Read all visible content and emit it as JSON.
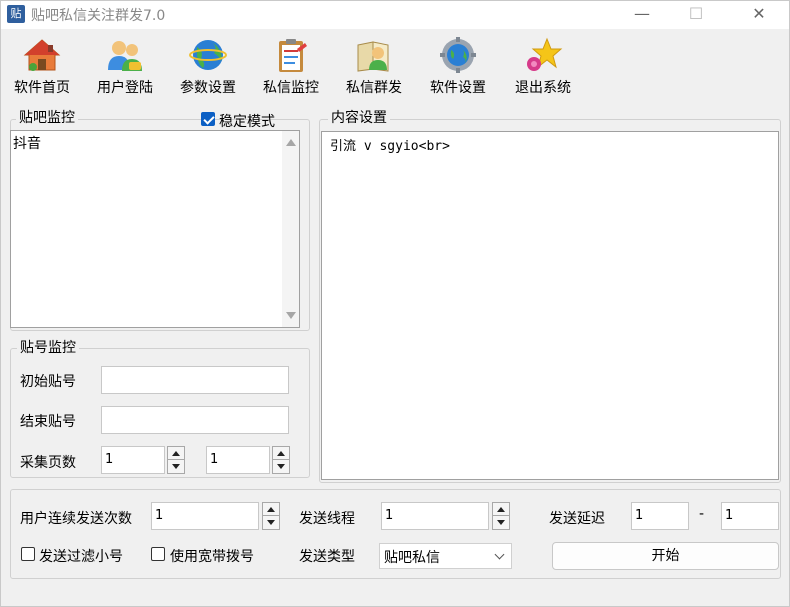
{
  "window": {
    "title": "贴吧私信关注群发7.0",
    "icon_text": "贴",
    "controls": {
      "minimize": "—",
      "maximize": "☐",
      "close": "✕"
    }
  },
  "toolbar": [
    {
      "id": "home",
      "label": "软件首页",
      "icon": "house-icon"
    },
    {
      "id": "login",
      "label": "用户登陆",
      "icon": "users-icon"
    },
    {
      "id": "params",
      "label": "参数设置",
      "icon": "globe-icon"
    },
    {
      "id": "monitor",
      "label": "私信监控",
      "icon": "clipboard-icon"
    },
    {
      "id": "mass",
      "label": "私信群发",
      "icon": "book-person-icon"
    },
    {
      "id": "settings",
      "label": "软件设置",
      "icon": "gear-globe-icon"
    },
    {
      "id": "exit",
      "label": "退出系统",
      "icon": "star-icon"
    }
  ],
  "tieba_monitor": {
    "legend": "贴吧监控",
    "stable_mode_label": "稳定模式",
    "stable_mode_checked": true,
    "content": "抖音"
  },
  "content_settings": {
    "legend": "内容设置",
    "content": "引流 v sgyio<br>"
  },
  "post_monitor": {
    "legend": "贴号监控",
    "start_label": "初始贴号",
    "start_value": "",
    "end_label": "结束贴号",
    "end_value": "",
    "pages_label": "采集页数",
    "pages_from": "1",
    "pages_to": "1"
  },
  "bottom": {
    "consecutive_label": "用户连续发送次数",
    "consecutive_value": "1",
    "threads_label": "发送线程",
    "threads_value": "1",
    "delay_label": "发送延迟",
    "delay_from": "1",
    "delay_sep": "-",
    "delay_to": "1",
    "filter_label": "发送过滤小号",
    "filter_checked": false,
    "broadband_label": "使用宽带拨号",
    "broadband_checked": false,
    "send_type_label": "发送类型",
    "send_type_value": "贴吧私信",
    "start_button": "开始"
  }
}
